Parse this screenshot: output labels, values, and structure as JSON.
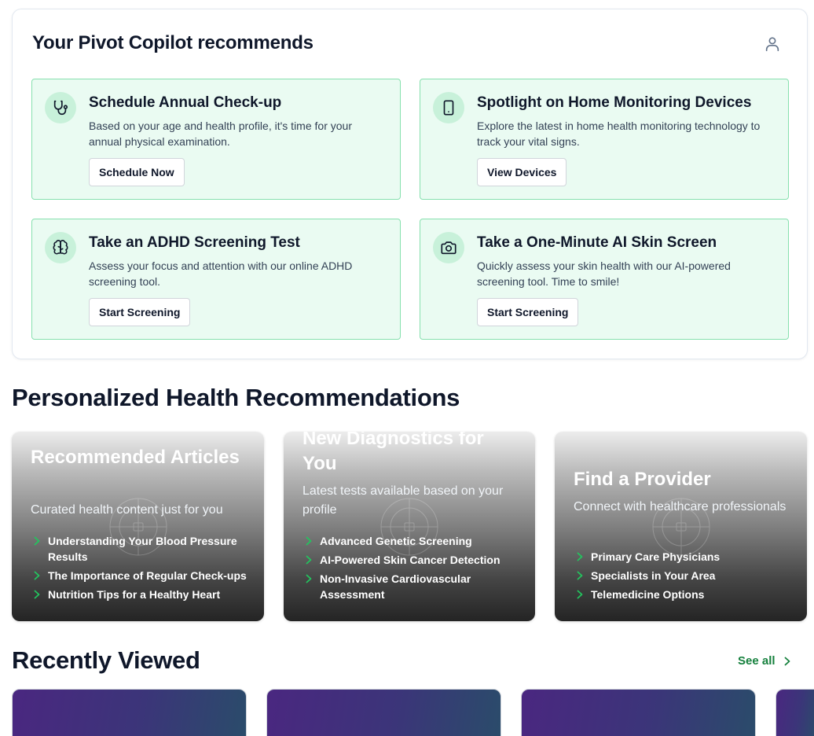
{
  "copilot": {
    "title": "Your Pivot Copilot recommends",
    "user_icon": "user-icon",
    "cards": [
      {
        "icon": "stethoscope-icon",
        "title": "Schedule Annual Check-up",
        "description": "Based on your age and health profile, it's time for your annual physical examination.",
        "button": "Schedule Now"
      },
      {
        "icon": "tablet-icon",
        "title": "Spotlight on Home Monitoring Devices",
        "description": "Explore the latest in home health monitoring technology to track your vital signs.",
        "button": "View Devices"
      },
      {
        "icon": "brain-icon",
        "title": "Take an ADHD Screening Test",
        "description": "Assess your focus and attention with our online ADHD screening tool.",
        "button": "Start Screening"
      },
      {
        "icon": "camera-icon",
        "title": "Take a One-Minute AI Skin Screen",
        "description": "Quickly assess your skin health with our AI-powered screening tool. Time to smile!",
        "button": "Start Screening"
      }
    ]
  },
  "personalized": {
    "title": "Personalized Health Recommendations",
    "cards": [
      {
        "title": "Recommended Articles",
        "subtitle": "Curated health content just for you",
        "items": [
          "Understanding Your Blood Pressure Results",
          "The Importance of Regular Check-ups",
          "Nutrition Tips for a Healthy Heart"
        ]
      },
      {
        "title": "New Diagnostics for You",
        "subtitle": "Latest tests available based on your profile",
        "items": [
          "Advanced Genetic Screening",
          "AI-Powered Skin Cancer Detection",
          "Non-Invasive Cardiovascular Assessment"
        ]
      },
      {
        "title": "Find a Provider",
        "subtitle": "Connect with healthcare professionals",
        "items": [
          "Primary Care Physicians",
          "Specialists in Your Area",
          "Telemedicine Options"
        ]
      }
    ]
  },
  "recently_viewed": {
    "title": "Recently Viewed",
    "see_all": "See all"
  },
  "colors": {
    "accent_green": "#15803d",
    "card_green_bg": "#eafbf2",
    "card_green_border": "#86e0ae",
    "chevron_green": "#22c55e"
  }
}
